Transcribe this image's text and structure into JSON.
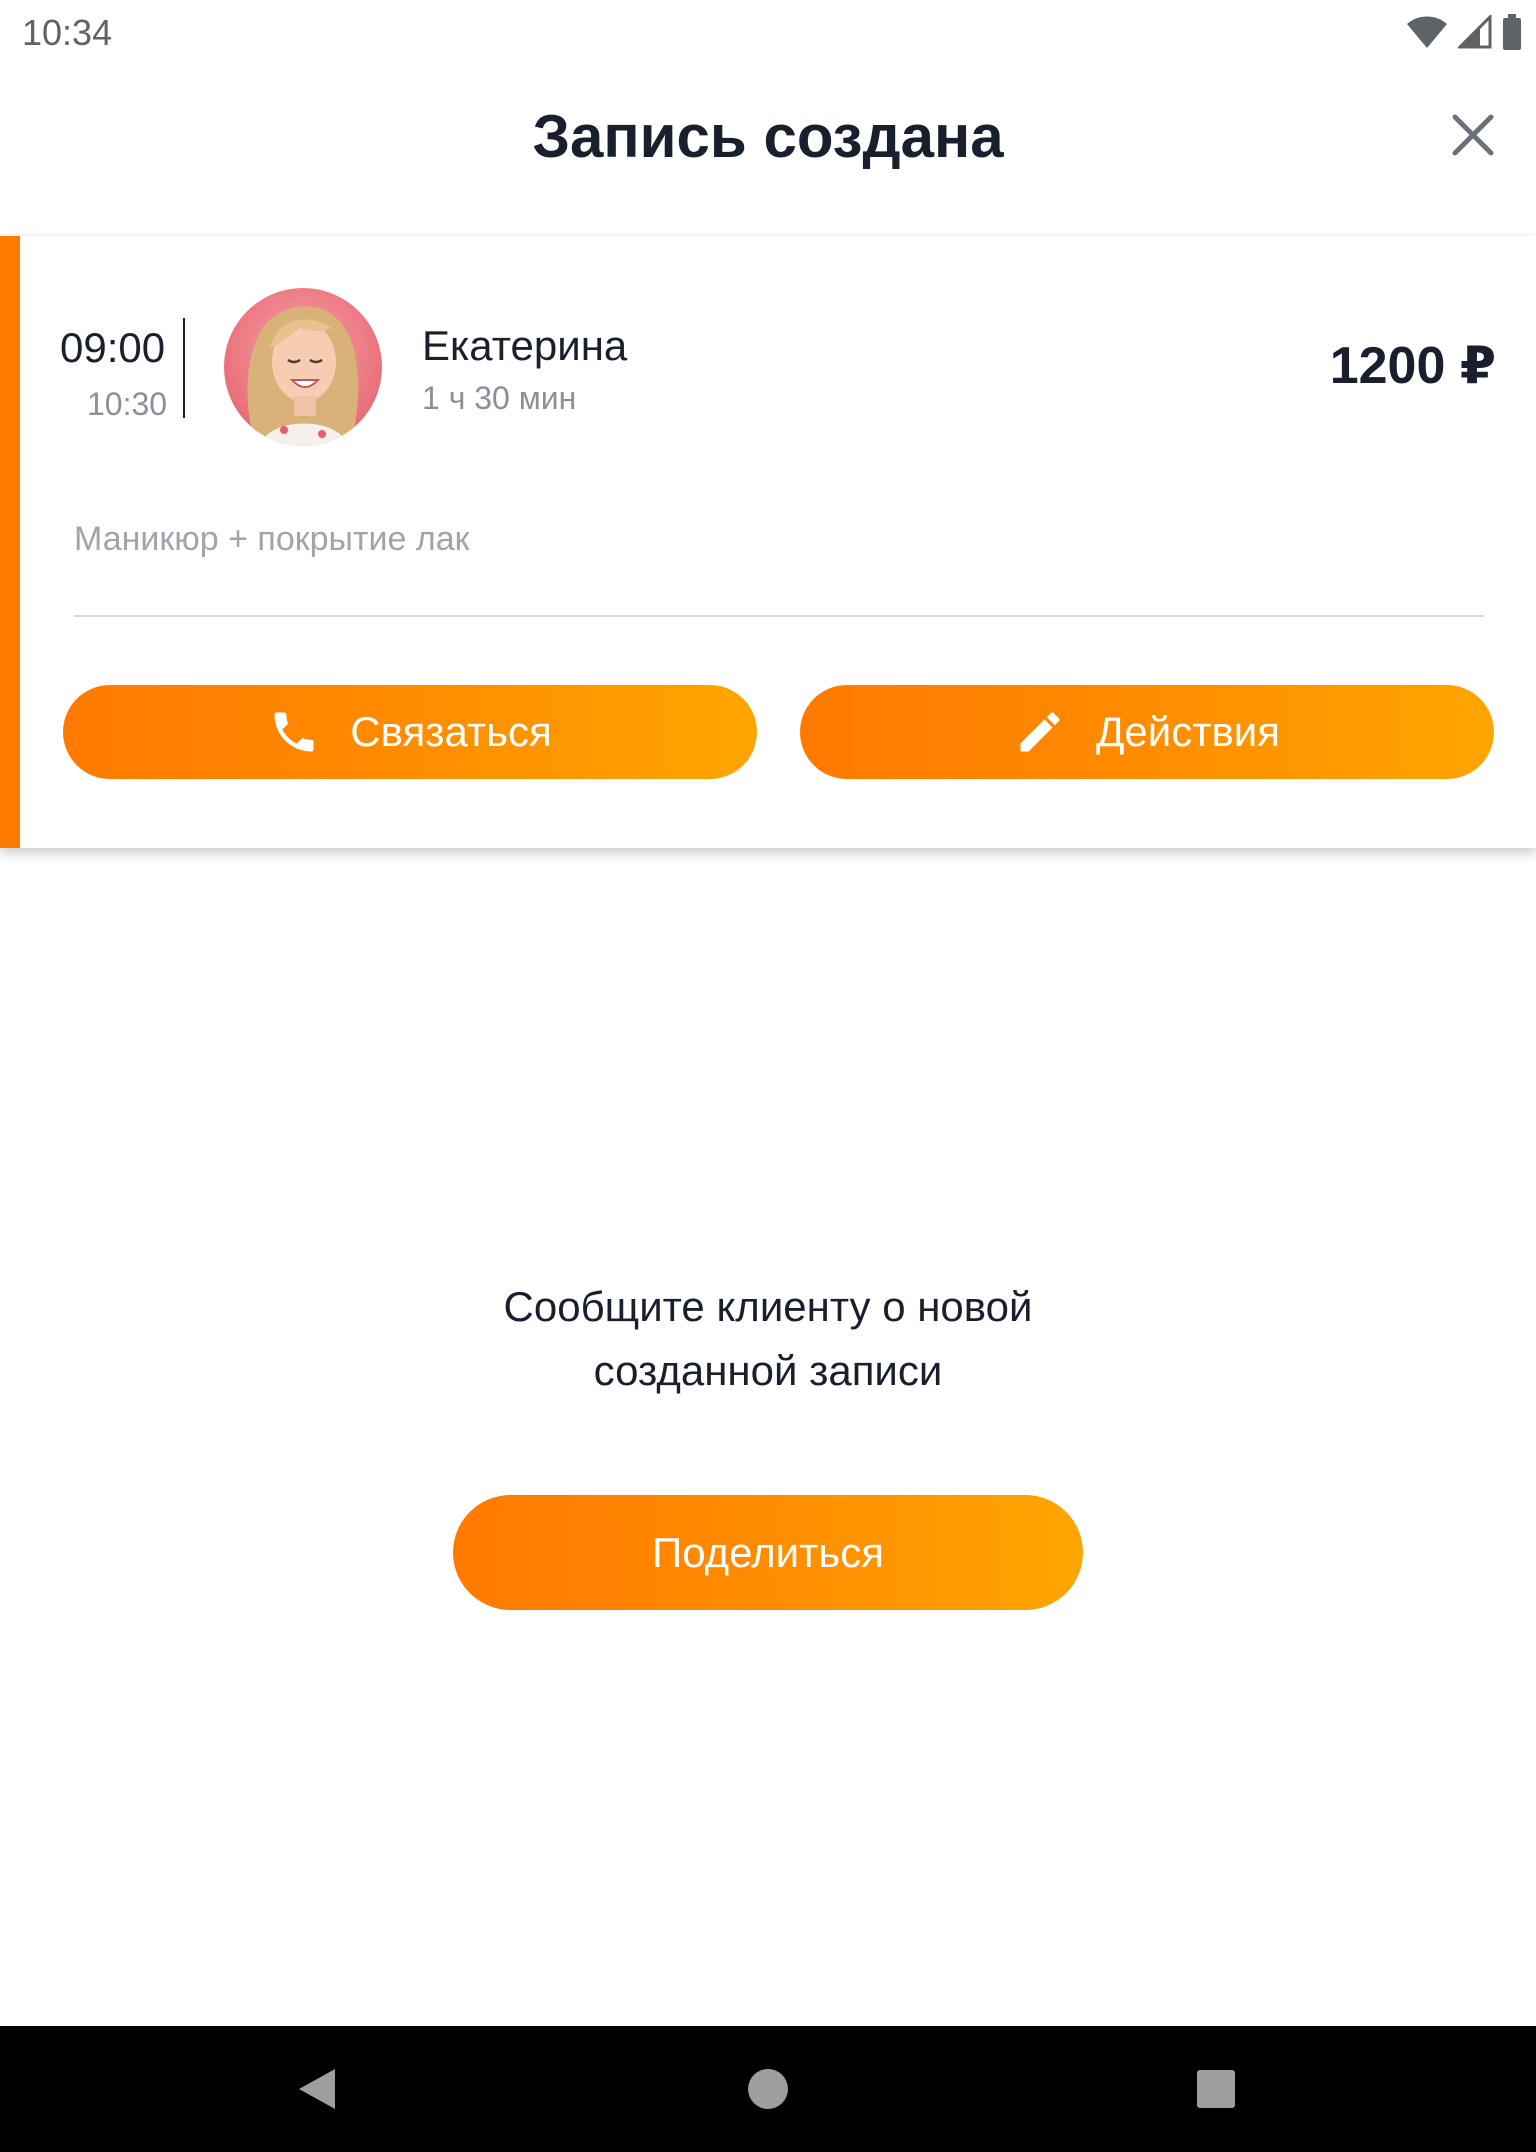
{
  "status_bar": {
    "time": "10:34",
    "icons": [
      "wifi-icon",
      "cell-signal-icon",
      "battery-icon"
    ]
  },
  "header": {
    "title": "Запись создана",
    "close_icon": "close-icon"
  },
  "appointment": {
    "time_start": "09:00",
    "time_end": "10:30",
    "client_name": "Екатерина",
    "duration": "1 ч 30 мин",
    "price": "1200 ₽",
    "service": "Маникюр + покрытие лак",
    "avatar": "client-photo",
    "buttons": {
      "contact_label": "Связаться",
      "contact_icon": "phone-icon",
      "actions_label": "Действия",
      "actions_icon": "pencil-icon"
    }
  },
  "message": {
    "line1": "Сообщите клиенту о новой",
    "line2": "созданной записи"
  },
  "share": {
    "label": "Поделиться"
  },
  "nav": {
    "icons": [
      "back-icon",
      "home-icon",
      "recents-icon"
    ]
  },
  "colors": {
    "accent": "#ff7a00",
    "gradient_end": "#ffa500",
    "text_primary": "#1a1f2e",
    "text_secondary": "#8a8f99"
  }
}
